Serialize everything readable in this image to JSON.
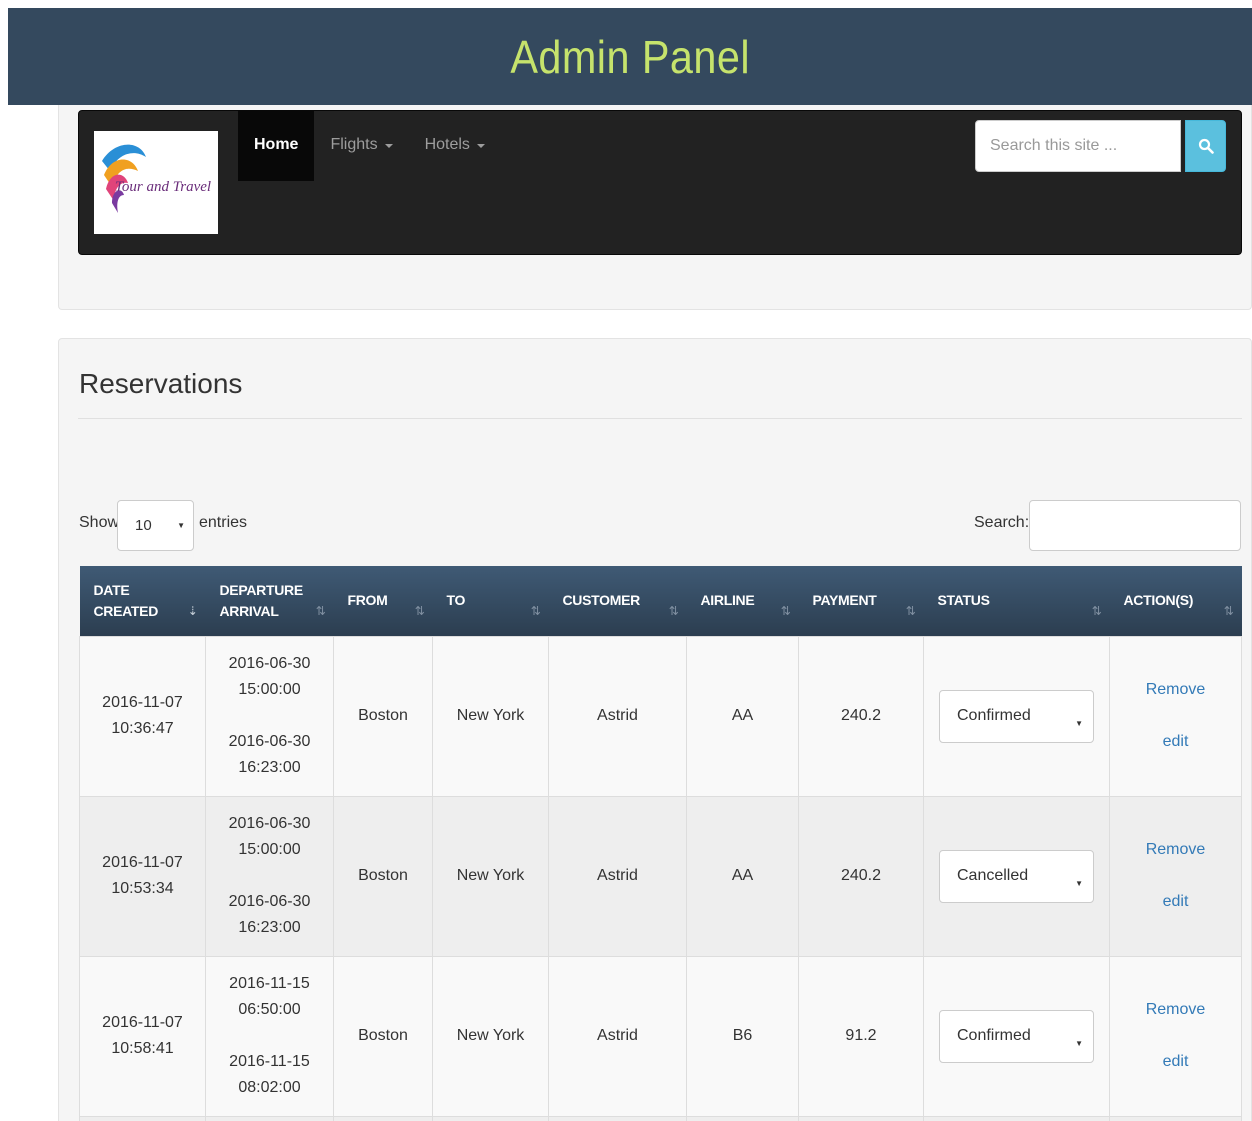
{
  "header": {
    "title": "Admin Panel"
  },
  "brand": {
    "logo_text": "Tour and Travel"
  },
  "nav": {
    "items": [
      {
        "label": "Home",
        "active": true,
        "dropdown": false
      },
      {
        "label": "Flights",
        "active": false,
        "dropdown": true
      },
      {
        "label": "Hotels",
        "active": false,
        "dropdown": true
      }
    ],
    "search_placeholder": "Search this site ...",
    "search_icon": "search-icon"
  },
  "reservations": {
    "title": "Reservations",
    "length_control": {
      "show_label": "Show",
      "value": "10",
      "entries_label": "entries"
    },
    "search_label": "Search:",
    "columns": [
      {
        "line1": "DATE",
        "line2": "CREATED",
        "sort": "desc"
      },
      {
        "line1": "DEPARTURE",
        "line2": "ARRIVAL",
        "sort": "both"
      },
      {
        "line1": "FROM",
        "line2": "",
        "sort": "both"
      },
      {
        "line1": "TO",
        "line2": "",
        "sort": "both"
      },
      {
        "line1": "CUSTOMER",
        "line2": "",
        "sort": "both"
      },
      {
        "line1": "AIRLINE",
        "line2": "",
        "sort": "both"
      },
      {
        "line1": "PAYMENT",
        "line2": "",
        "sort": "both"
      },
      {
        "line1": "STATUS",
        "line2": "",
        "sort": "both"
      },
      {
        "line1": "ACTION(S)",
        "line2": "",
        "sort": "both"
      }
    ],
    "rows": [
      {
        "created_date": "2016-11-07",
        "created_time": "10:36:47",
        "dep_date": "2016-06-30",
        "dep_time": "15:00:00",
        "arr_date": "2016-06-30",
        "arr_time": "16:23:00",
        "from": "Boston",
        "to": "New York",
        "customer": "Astrid",
        "airline": "AA",
        "payment": "240.2",
        "status": "Confirmed",
        "remove_label": "Remove",
        "edit_label": "edit"
      },
      {
        "created_date": "2016-11-07",
        "created_time": "10:53:34",
        "dep_date": "2016-06-30",
        "dep_time": "15:00:00",
        "arr_date": "2016-06-30",
        "arr_time": "16:23:00",
        "from": "Boston",
        "to": "New York",
        "customer": "Astrid",
        "airline": "AA",
        "payment": "240.2",
        "status": "Cancelled",
        "remove_label": "Remove",
        "edit_label": "edit"
      },
      {
        "created_date": "2016-11-07",
        "created_time": "10:58:41",
        "dep_date": "2016-11-15",
        "dep_time": "06:50:00",
        "arr_date": "2016-11-15",
        "arr_time": "08:02:00",
        "from": "Boston",
        "to": "New York",
        "customer": "Astrid",
        "airline": "B6",
        "payment": "91.2",
        "status": "Confirmed",
        "remove_label": "Remove",
        "edit_label": "edit"
      }
    ]
  },
  "colors": {
    "header_bg": "#34495e",
    "header_title": "#c6e36c",
    "navbar_bg": "#222222",
    "search_button": "#5bc0de",
    "link": "#337ab7"
  }
}
